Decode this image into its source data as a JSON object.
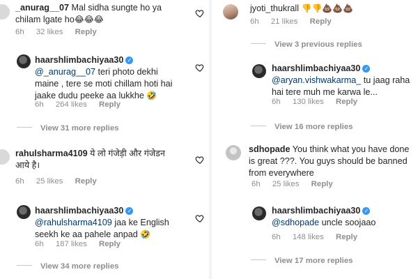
{
  "left": {
    "c1": {
      "username": "_anurag__07",
      "text_a": "Mal sidha sungte ho ya",
      "text_b": "chilam lgate ho",
      "emoji": "😂😂😂",
      "time": "6h",
      "likes": "32 likes",
      "reply": "Reply"
    },
    "r1": {
      "username": "haarshlimbachiyaa30",
      "mention": "@_anurag__07",
      "text_a": "teri photo dekhi",
      "text_b": "maine , tere se moti chillam hoti hai",
      "text_c": "jaake dudu peeke aa lukkhe",
      "emoji": "🤣",
      "time": "6h",
      "likes": "264 likes",
      "reply": "Reply"
    },
    "v1": "View 31 more replies",
    "c2": {
      "username": "rahulsharma4109",
      "text_a": "ये लो गंजेड़ी और गंजेडन",
      "text_b": "आये है।",
      "time": "6h",
      "likes": "25 likes",
      "reply": "Reply"
    },
    "r2": {
      "username": "haarshlimbachiyaa30",
      "mention": "@rahulsharma4109",
      "text_a": "jaa ke English",
      "text_b": "seekh ke aa pahele anpad",
      "emoji": "🤣",
      "time": "6h",
      "likes": "187 likes",
      "reply": "Reply"
    },
    "v2": "View 34 more replies"
  },
  "right": {
    "c1": {
      "username": "jyoti_thukrall",
      "emoji": "👎👎💩💩💩",
      "time": "6h",
      "likes": "21 likes",
      "reply": "Reply"
    },
    "v0": "View 3 previous replies",
    "r1": {
      "username": "haarshlimbachiyaa30",
      "mention": "@aryan.vishwakarma_",
      "text_a": "tu jaag raha",
      "text_b": "hai tere muh me karwa le...",
      "time": "6h",
      "likes": "130 likes",
      "reply": "Reply"
    },
    "v1": "View 16 more replies",
    "c2": {
      "username": "sdhopade",
      "text_a": "You think what you have done",
      "text_b": "is great ???. You guys should be banned",
      "text_c": "from everywhere",
      "time": "6h",
      "likes": "25 likes",
      "reply": "Reply"
    },
    "r2": {
      "username": "haarshlimbachiyaa30",
      "mention": "@sdhopade",
      "text_a": "uncle soojaao",
      "time": "6h",
      "likes": "148 likes",
      "reply": "Reply"
    },
    "v2": "View 17 more replies"
  },
  "icons": {
    "like": "heart-outline-icon",
    "verified": "verified-badge-icon"
  }
}
